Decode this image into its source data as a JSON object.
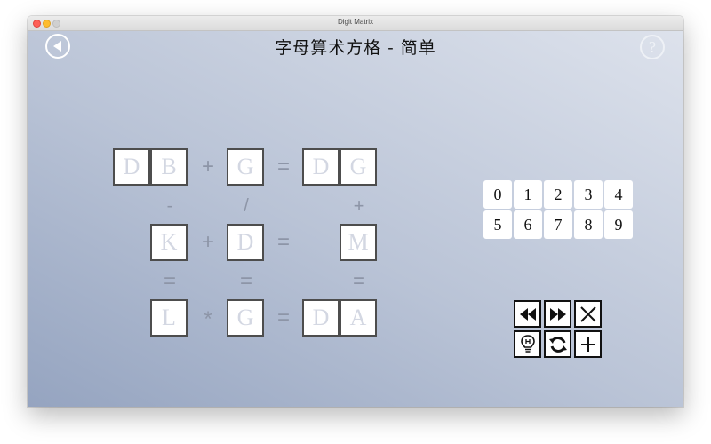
{
  "window": {
    "title": "Digit Matrix"
  },
  "page": {
    "title": "字母算术方格 - 简单"
  },
  "puzzle": {
    "row1": {
      "a": [
        "D",
        "B"
      ],
      "op1": "+",
      "b": [
        "G"
      ],
      "eq": "=",
      "c": [
        "D",
        "G"
      ]
    },
    "col_ops": [
      "-",
      "/",
      "+"
    ],
    "row2": {
      "a": [
        "K"
      ],
      "op1": "+",
      "b": [
        "D"
      ],
      "eq": "=",
      "c": [
        "M"
      ]
    },
    "col_eqs": [
      "=",
      "=",
      "="
    ],
    "row3": {
      "a": [
        "L"
      ],
      "op1": "*",
      "b": [
        "G"
      ],
      "eq": "=",
      "c": [
        "D",
        "A"
      ]
    }
  },
  "digits": [
    "0",
    "1",
    "2",
    "3",
    "4",
    "5",
    "6",
    "7",
    "8",
    "9"
  ],
  "controls": {
    "rewind": "rewind-icon",
    "fast_forward": "fast-forward-icon",
    "clear": "close-icon",
    "hint": "lightbulb-icon",
    "restart": "refresh-icon",
    "new_game": "plus-icon"
  },
  "colors": {
    "letter": "#d3d7e2",
    "operator": "#8d95a7",
    "cell_border": "#4d4d4d"
  }
}
